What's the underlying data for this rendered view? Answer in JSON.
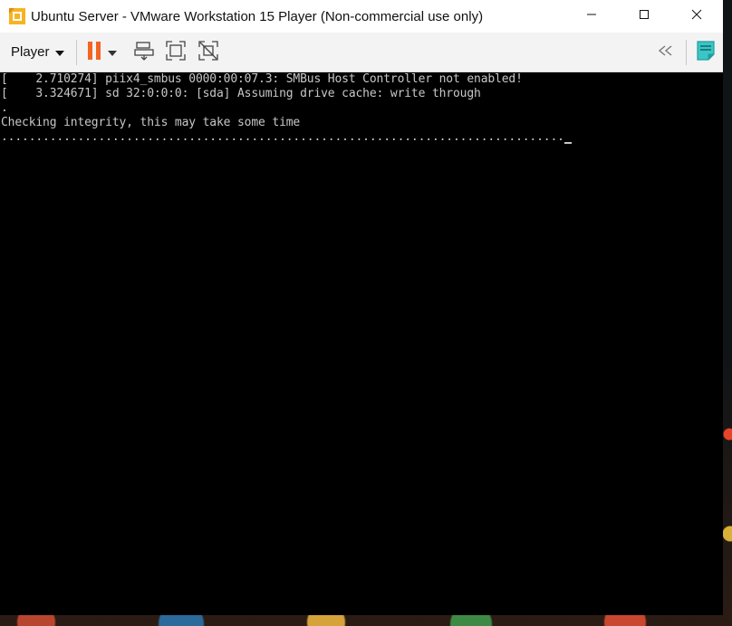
{
  "window": {
    "title": "Ubuntu Server - VMware Workstation 15 Player (Non-commercial use only)",
    "controls": {
      "minimize_icon": "minimize-icon",
      "maximize_icon": "maximize-icon",
      "close_icon": "close-icon"
    }
  },
  "toolbar": {
    "player_label": "Player",
    "icons": [
      "pause-icon",
      "dropdown-arrow-icon",
      "send-ctrl-alt-del-icon",
      "full-screen-icon",
      "unity-icon",
      "collapse-toolbar-icon",
      "message-log-icon"
    ],
    "pause_color": "#f26522",
    "notes_color": "#1f9e9e"
  },
  "console": {
    "lines": [
      "[    2.710274] piix4_smbus 0000:00:07.3: SMBus Host Controller not enabled!",
      "[    3.324671] sd 32:0:0:0: [sda] Assuming drive cache: write through",
      ".",
      "Checking integrity, this may take some time",
      "................................................................................."
    ]
  }
}
